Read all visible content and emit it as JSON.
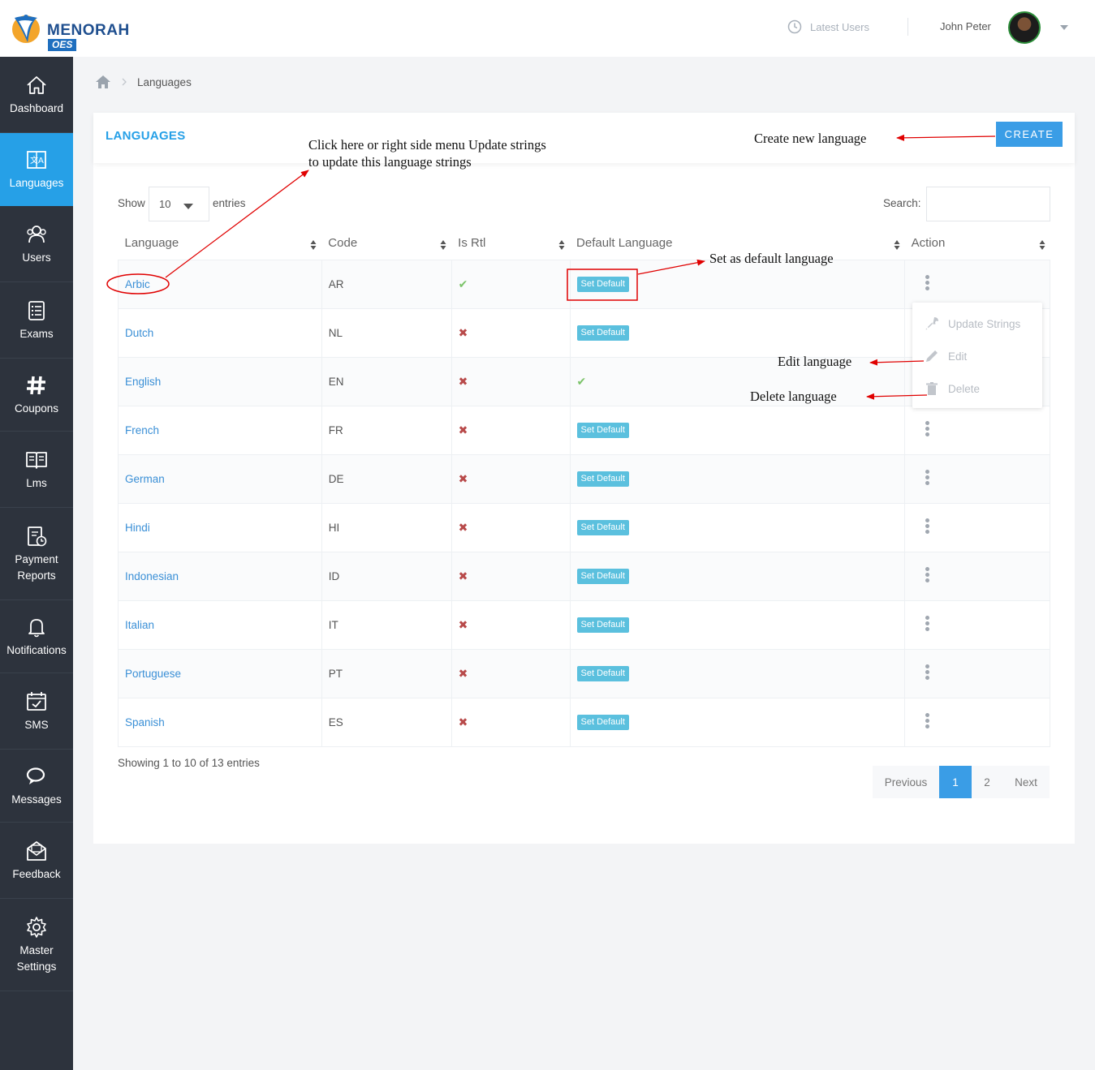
{
  "header": {
    "logo_text": "MENORAH",
    "logo_sub": "OES",
    "latest_users": "Latest Users",
    "user_name": "John Peter"
  },
  "sidebar": {
    "items": [
      {
        "label": "Dashboard",
        "icon": "home-icon"
      },
      {
        "label": "Languages",
        "icon": "translate-icon",
        "active": true
      },
      {
        "label": "Users",
        "icon": "users-icon"
      },
      {
        "label": "Exams",
        "icon": "exams-icon"
      },
      {
        "label": "Coupons",
        "icon": "hash-icon"
      },
      {
        "label": "Lms",
        "icon": "book-icon"
      },
      {
        "label": "Payment Reports",
        "icon": "report-icon"
      },
      {
        "label": "Notifications",
        "icon": "bell-icon"
      },
      {
        "label": "SMS",
        "icon": "calendar-check-icon"
      },
      {
        "label": "Messages",
        "icon": "chat-icon"
      },
      {
        "label": "Feedback",
        "icon": "envelope-icon"
      },
      {
        "label": "Master Settings",
        "icon": "gear-icon"
      }
    ]
  },
  "breadcrumb": {
    "current": "Languages"
  },
  "panel": {
    "title": "LANGUAGES",
    "create_label": "CREATE"
  },
  "table_controls": {
    "show_label": "Show",
    "page_size": "10",
    "entries_label": "entries",
    "search_label": "Search:"
  },
  "table": {
    "columns": [
      "Language",
      "Code",
      "Is Rtl",
      "Default Language",
      "Action"
    ],
    "set_default_label": "Set Default",
    "rows": [
      {
        "language": "Arbic",
        "code": "AR",
        "rtl": true,
        "default": false
      },
      {
        "language": "Dutch",
        "code": "NL",
        "rtl": false,
        "default": false
      },
      {
        "language": "English",
        "code": "EN",
        "rtl": false,
        "default": true
      },
      {
        "language": "French",
        "code": "FR",
        "rtl": false,
        "default": false
      },
      {
        "language": "German",
        "code": "DE",
        "rtl": false,
        "default": false
      },
      {
        "language": "Hindi",
        "code": "HI",
        "rtl": false,
        "default": false
      },
      {
        "language": "Indonesian",
        "code": "ID",
        "rtl": false,
        "default": false
      },
      {
        "language": "Italian",
        "code": "IT",
        "rtl": false,
        "default": false
      },
      {
        "language": "Portuguese",
        "code": "PT",
        "rtl": false,
        "default": false
      },
      {
        "language": "Spanish",
        "code": "ES",
        "rtl": false,
        "default": false
      }
    ]
  },
  "action_menu": {
    "update": "Update Strings",
    "edit": "Edit",
    "delete": "Delete"
  },
  "footer": {
    "info": "Showing 1 to 10 of 13 entries",
    "pagination": {
      "previous": "Previous",
      "pages": [
        "1",
        "2"
      ],
      "current": "1",
      "next": "Next"
    }
  },
  "annotations": {
    "click_line1": "Click here or right side menu Update strings",
    "click_line2": "to update this language strings",
    "create": "Create new language",
    "set_default": "Set as default language",
    "edit": "Edit language",
    "delete": "Delete language"
  },
  "colors": {
    "accent": "#26a0e7",
    "sidebar": "#2d333d",
    "badge": "#5bc0de",
    "annotation": "#e00000"
  }
}
